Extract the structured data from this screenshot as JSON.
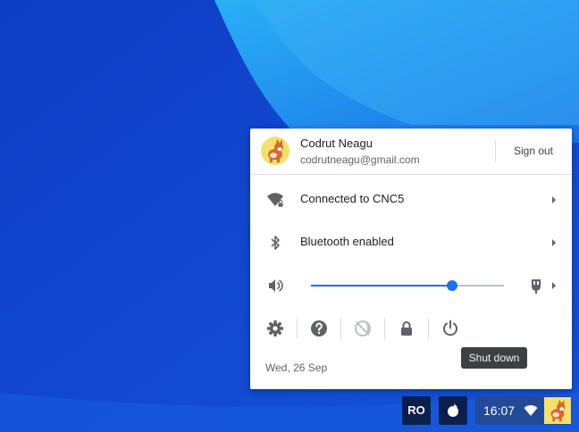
{
  "user": {
    "name": "Codrut Neagu",
    "email": "codrutneagu@gmail.com",
    "sign_out_label": "Sign out"
  },
  "network": {
    "label": "Connected to CNC5",
    "icon": "wifi-locked-icon"
  },
  "bluetooth": {
    "label": "Bluetooth enabled",
    "icon": "bluetooth-icon"
  },
  "volume": {
    "icon": "volume-icon",
    "level": 0.73,
    "output_icon": "headset-icon"
  },
  "actions": [
    {
      "name": "settings",
      "icon": "gear-icon",
      "enabled": true
    },
    {
      "name": "help",
      "icon": "help-icon",
      "enabled": true
    },
    {
      "name": "night-light",
      "icon": "night-light-icon",
      "enabled": false
    },
    {
      "name": "lock",
      "icon": "lock-icon",
      "enabled": true
    },
    {
      "name": "shut-down",
      "icon": "power-icon",
      "enabled": true
    }
  ],
  "tooltip": "Shut down",
  "date": "Wed, 26 Sep",
  "shelf": {
    "ime": "RO",
    "time": "16:07",
    "stylus_icon": "stylus-icon",
    "wifi_icon": "wifi-icon"
  },
  "colors": {
    "accent": "#1a73e8",
    "wallpaper_dark": "#1346c9",
    "wallpaper_light": "#2a9df0",
    "shelf_badge": "#0b1f4d"
  }
}
